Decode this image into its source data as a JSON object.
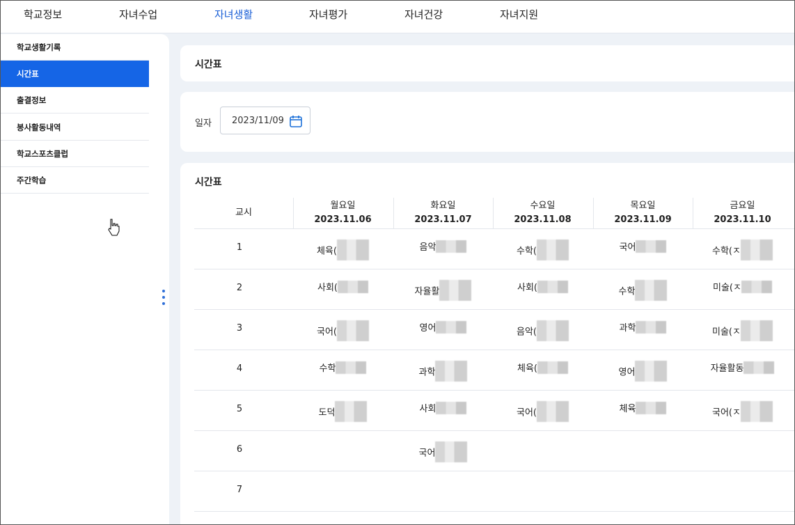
{
  "topnav": {
    "items": [
      "학교정보",
      "자녀수업",
      "자녀생활",
      "자녀평가",
      "자녀건강",
      "자녀지원"
    ],
    "active_index": 2
  },
  "sidebar": {
    "items": [
      "학교생활기록",
      "시간표",
      "출결정보",
      "봉사활동내역",
      "학교스포츠클럽",
      "주간학습"
    ],
    "active_index": 1
  },
  "header_card": {
    "title": "시간표"
  },
  "date_filter": {
    "label": "일자",
    "value": "2023/11/09"
  },
  "timetable": {
    "title": "시간표",
    "period_header": "교시",
    "days": [
      {
        "name": "월요일",
        "date": "2023.11.06"
      },
      {
        "name": "화요일",
        "date": "2023.11.07"
      },
      {
        "name": "수요일",
        "date": "2023.11.08"
      },
      {
        "name": "목요일",
        "date": "2023.11.09"
      },
      {
        "name": "금요일",
        "date": "2023.11.10"
      }
    ],
    "periods": [
      "1",
      "2",
      "3",
      "4",
      "5",
      "6",
      "7"
    ],
    "rows": [
      [
        "체육(",
        "음악",
        "수학(",
        "국어",
        "수학(ㅈ"
      ],
      [
        "사회(",
        "자율활",
        "사회(",
        "수학",
        "미술(ㅈ"
      ],
      [
        "국어(",
        "영어",
        "음악(",
        "과학",
        "미술(ㅈ"
      ],
      [
        "수학",
        "과학",
        "체육(",
        "영어",
        "자율활동"
      ],
      [
        "도덕",
        "사회",
        "국어(",
        "체육",
        "국어(ㅈ"
      ],
      [
        "",
        "국어",
        "",
        "",
        ""
      ],
      [
        "",
        "",
        "",
        "",
        ""
      ]
    ]
  },
  "colors": {
    "accent": "#1565e6",
    "nav_active": "#1a5fd6"
  }
}
